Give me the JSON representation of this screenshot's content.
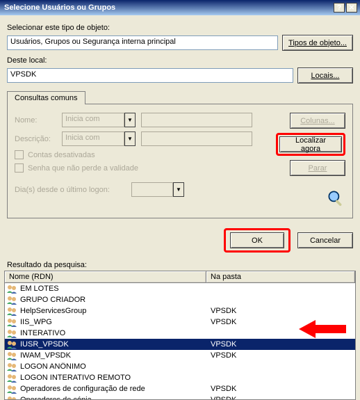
{
  "title": "Selecione Usuários ou Grupos",
  "section1": {
    "label": "Selecionar este tipo de objeto:",
    "value": "Usuários, Grupos ou Segurança interna principal",
    "button": "Tipos de objeto..."
  },
  "section2": {
    "label": "Deste local:",
    "value": "VPSDK",
    "button": "Locais..."
  },
  "tab": "Consultas comuns",
  "form": {
    "nameLbl": "Nome:",
    "descLbl": "Descrição:",
    "comboText": "Inicia com",
    "chk1": "Contas desativadas",
    "chk2": "Senha que não perde a validade",
    "daysLbl": "Dia(s) desde o último logon:"
  },
  "sideBtns": {
    "cols": "Colunas...",
    "find": "Localizar agora",
    "stop": "Parar"
  },
  "actions": {
    "ok": "OK",
    "cancel": "Cancelar"
  },
  "resultLabel": "Resultado da pesquisa:",
  "headers": {
    "name": "Nome (RDN)",
    "folder": "Na pasta"
  },
  "rows": [
    {
      "name": "EM LOTES",
      "folder": ""
    },
    {
      "name": "GRUPO CRIADOR",
      "folder": ""
    },
    {
      "name": "HelpServicesGroup",
      "folder": "VPSDK"
    },
    {
      "name": "IIS_WPG",
      "folder": "VPSDK"
    },
    {
      "name": "INTERATIVO",
      "folder": ""
    },
    {
      "name": "IUSR_VPSDK",
      "folder": "VPSDK",
      "selected": true
    },
    {
      "name": "IWAM_VPSDK",
      "folder": "VPSDK"
    },
    {
      "name": "LOGON ANÔNIMO",
      "folder": ""
    },
    {
      "name": "LOGON INTERATIVO REMOTO",
      "folder": ""
    },
    {
      "name": "Operadores de configuração de rede",
      "folder": "VPSDK"
    },
    {
      "name": "Operadores de cópia",
      "folder": "VPSDK"
    }
  ]
}
